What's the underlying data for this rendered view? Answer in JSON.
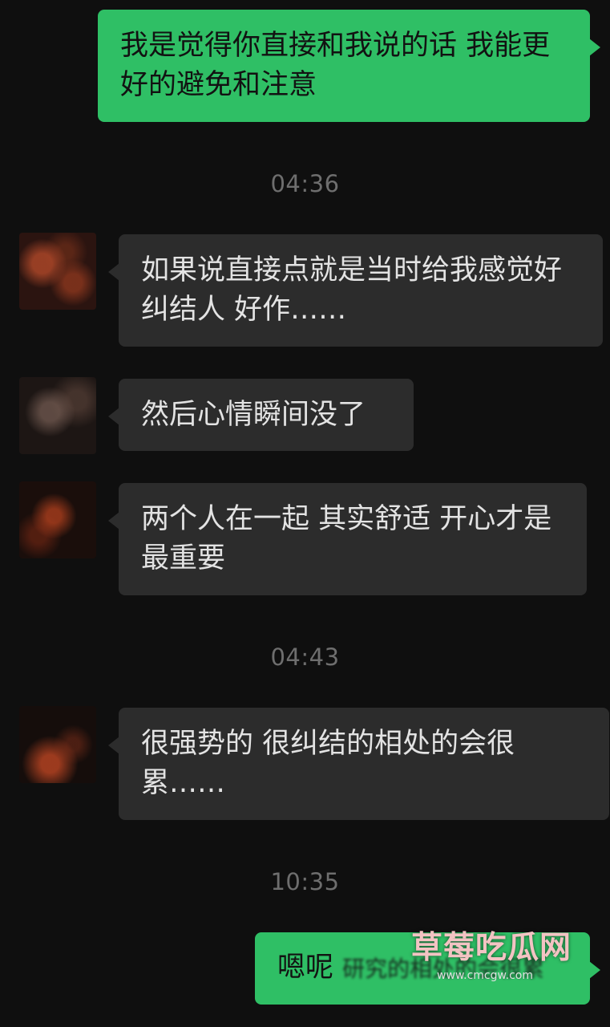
{
  "messages": [
    {
      "direction": "out",
      "text": "我是觉得你直接和我说的话 我能更好的避免和注意"
    },
    {
      "type": "time",
      "text": "04:36"
    },
    {
      "direction": "in",
      "text": "如果说直接点就是当时给我感觉好纠结人 好作……"
    },
    {
      "direction": "in",
      "text": "然后心情瞬间没了"
    },
    {
      "direction": "in",
      "text": "两个人在一起 其实舒适 开心才是最重要"
    },
    {
      "type": "time",
      "text": "04:43"
    },
    {
      "direction": "in",
      "text": "很强势的 很纠结的相处的会很累……"
    },
    {
      "type": "time",
      "text": "10:35"
    },
    {
      "direction": "out",
      "text": "嗯呢",
      "blurred_suffix": "研究的相处的会很累"
    }
  ],
  "watermark": {
    "title": "草莓吃瓜网",
    "url": "www.cmcgw.com"
  },
  "colors": {
    "background": "#0f0f0f",
    "outgoing_bubble": "#2fbf65",
    "incoming_bubble": "#2c2c2c",
    "timestamp": "#6e6e6e"
  }
}
